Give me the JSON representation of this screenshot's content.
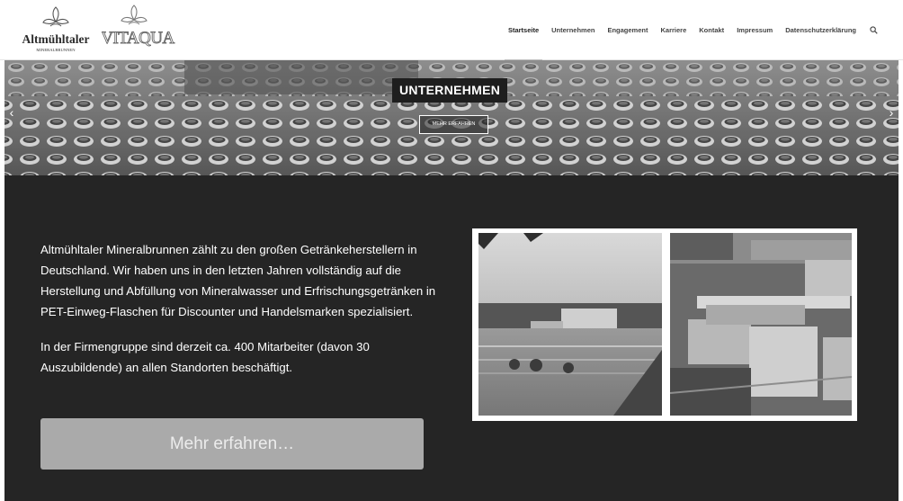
{
  "header": {
    "logos": [
      {
        "name": "Altmühltaler",
        "subtitle": "MINERALBRUNNEN"
      },
      {
        "name": "VITAQUA"
      }
    ],
    "nav": [
      {
        "label": "Startseite",
        "active": true
      },
      {
        "label": "Unternehmen",
        "active": false
      },
      {
        "label": "Engagement",
        "active": false
      },
      {
        "label": "Karriere",
        "active": false
      },
      {
        "label": "Kontakt",
        "active": false
      },
      {
        "label": "Impressum",
        "active": false
      },
      {
        "label": "Datenschutzerklärung",
        "active": false
      }
    ],
    "search_icon": "search-icon"
  },
  "hero": {
    "title": "UNTERNEHMEN",
    "button_label": "MEHR ERFAHREN",
    "prev_icon": "chevron-left-icon",
    "next_icon": "chevron-right-icon"
  },
  "content": {
    "paragraph_1": "Altmühltaler Mineralbrunnen zählt zu den großen Getränkeherstellern in Deutschland. Wir haben uns in den letzten Jahren vollständig auf die Herstellung und Abfüllung von Mineralwasser und Erfrischungsgetränken in PET-Einweg-Flaschen für Discounter und Handelsmarken spezialisiert.",
    "paragraph_2": "In der Firmengruppe sind derzeit ca. 400 Mitarbeiter (davon 30 Auszubildende) an allen Standorten beschäftigt.",
    "more_button": "Mehr erfahren…"
  },
  "colors": {
    "dark_section": "#252525",
    "button": "#aaaaaa",
    "header_bg": "#ffffff"
  }
}
